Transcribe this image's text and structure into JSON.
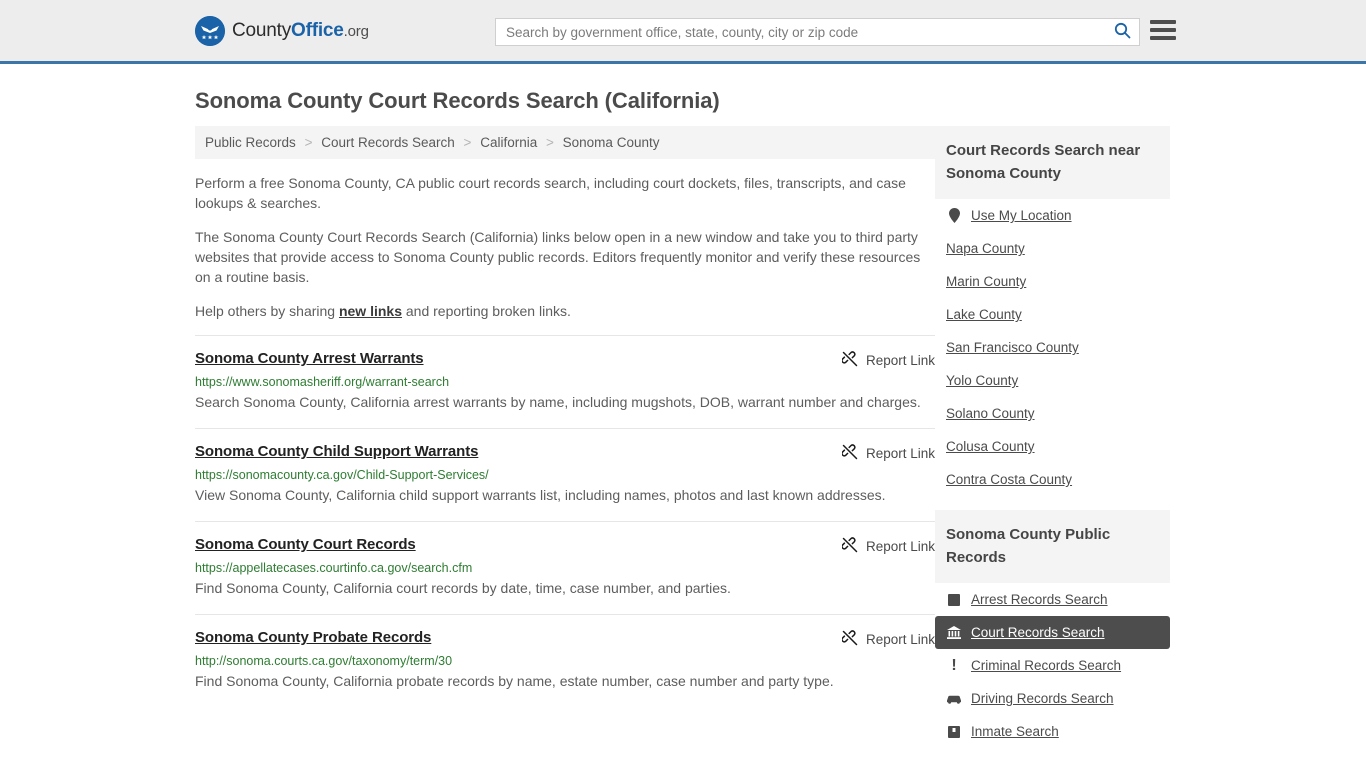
{
  "header": {
    "logo": {
      "part1": "County",
      "part2": "Office",
      "part3": ".org",
      "icon": "eagle-seal-icon"
    },
    "search": {
      "placeholder": "Search by government office, state, county, city or zip code",
      "value": "",
      "icon": "search-icon"
    },
    "menu_icon": "hamburger-menu-icon",
    "brand_blue": "#1b63a8",
    "border_blue": "#3c75a8"
  },
  "page": {
    "title": "Sonoma County Court Records Search (California)"
  },
  "breadcrumb": {
    "separator": ">",
    "items": [
      {
        "label": "Public Records"
      },
      {
        "label": "Court Records Search"
      },
      {
        "label": "California"
      },
      {
        "label": "Sonoma County"
      }
    ]
  },
  "intro": {
    "p1": "Perform a free Sonoma County, CA public court records search, including court dockets, files, transcripts, and case lookups & searches.",
    "p2": "The Sonoma County Court Records Search (California) links below open in a new window and take you to third party websites that provide access to Sonoma County public records. Editors frequently monitor and verify these resources on a routine basis.",
    "p3_before": "Help others by sharing ",
    "p3_link": "new links",
    "p3_after": " and reporting broken links."
  },
  "results": {
    "report_label": "Report Link",
    "report_icon": "broken-link-icon",
    "items": [
      {
        "title": "Sonoma County Arrest Warrants",
        "url": "https://www.sonomasheriff.org/warrant-search",
        "description": "Search Sonoma County, California arrest warrants by name, including mugshots, DOB, warrant number and charges."
      },
      {
        "title": "Sonoma County Child Support Warrants",
        "url": "https://sonomacounty.ca.gov/Child-Support-Services/",
        "description": "View Sonoma County, California child support warrants list, including names, photos and last known addresses."
      },
      {
        "title": "Sonoma County Court Records",
        "url": "https://appellatecases.courtinfo.ca.gov/search.cfm",
        "description": "Find Sonoma County, California court records by date, time, case number, and parties."
      },
      {
        "title": "Sonoma County Probate Records",
        "url": "http://sonoma.courts.ca.gov/taxonomy/term/30",
        "description": "Find Sonoma County, California probate records by name, estate number, case number and party type."
      }
    ]
  },
  "sidebar": {
    "nearby": {
      "heading": "Court Records Search near Sonoma County",
      "items": [
        {
          "label": "Use My Location",
          "icon": "map-pin-icon"
        },
        {
          "label": "Napa County",
          "icon": ""
        },
        {
          "label": "Marin County",
          "icon": ""
        },
        {
          "label": "Lake County",
          "icon": ""
        },
        {
          "label": "San Francisco County",
          "icon": ""
        },
        {
          "label": "Yolo County",
          "icon": ""
        },
        {
          "label": "Solano County",
          "icon": ""
        },
        {
          "label": "Colusa County",
          "icon": ""
        },
        {
          "label": "Contra Costa County",
          "icon": ""
        }
      ]
    },
    "public_records": {
      "heading": "Sonoma County Public Records",
      "active_label": "Court Records Search",
      "items": [
        {
          "label": "Arrest Records Search",
          "icon": "fingerprint-icon",
          "active": false
        },
        {
          "label": "Court Records Search",
          "icon": "courthouse-icon",
          "active": true
        },
        {
          "label": "Criminal Records Search",
          "icon": "exclamation-icon",
          "active": false
        },
        {
          "label": "Driving Records Search",
          "icon": "car-icon",
          "active": false
        },
        {
          "label": "Inmate Search",
          "icon": "jail-icon",
          "active": false
        }
      ],
      "active_bg": "#4d4d4d"
    }
  }
}
